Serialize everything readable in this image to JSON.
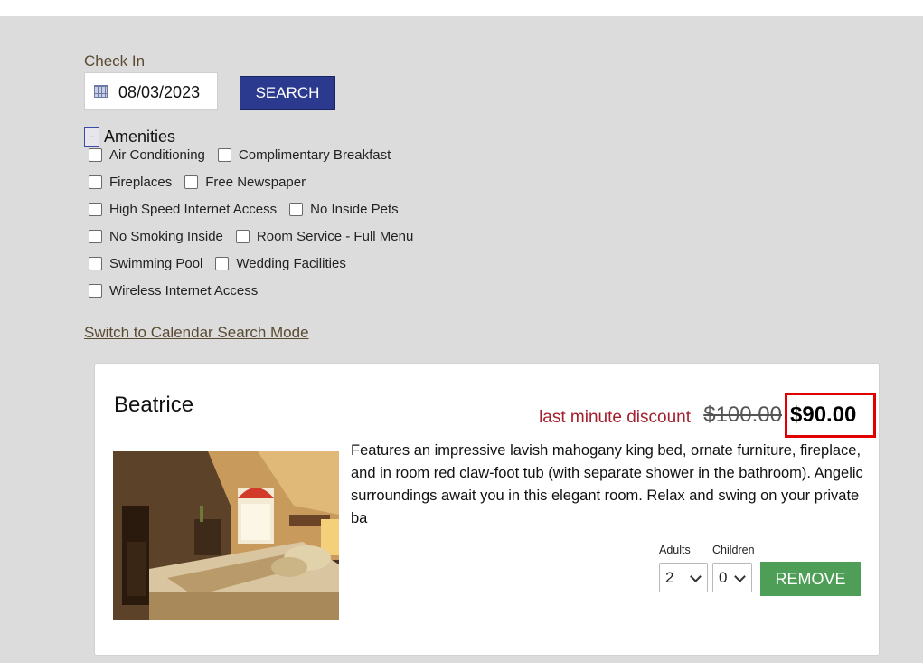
{
  "search": {
    "checkin_label": "Check In",
    "date_value": "08/03/2023",
    "search_button": "SEARCH"
  },
  "amenities": {
    "toggle_symbol": "-",
    "title": "Amenities",
    "items": [
      "Air Conditioning",
      "Complimentary Breakfast",
      "Fireplaces",
      "Free Newspaper",
      "High Speed Internet Access",
      "No Inside Pets",
      "No Smoking Inside",
      "Room Service - Full Menu",
      "Swimming Pool",
      "Wedding Facilities",
      "Wireless Internet Access"
    ],
    "switch_link": "Switch to Calendar Search Mode"
  },
  "room": {
    "name": "Beatrice",
    "discount_label": "last minute discount",
    "original_price": "$100.00",
    "price": "$90.00",
    "description": "Features an impressive lavish mahogany king bed, ornate furniture, fireplace, and in room red claw-foot tub (with separate shower in the bathroom). Angelic surroundings await you in this elegant room. Relax and swing on your private ba",
    "adults_label": "Adults",
    "adults_value": "2",
    "children_label": "Children",
    "children_value": "0",
    "remove_button": "REMOVE"
  },
  "colors": {
    "search_button": "#2b3a8f",
    "remove_button": "#4f9e57",
    "discount_text": "#a31f2e",
    "price_highlight": "#e00000",
    "panel_background": "#dcdcdc"
  },
  "icons": {
    "date": "calendar-icon",
    "select": "chevron-down-icon"
  }
}
